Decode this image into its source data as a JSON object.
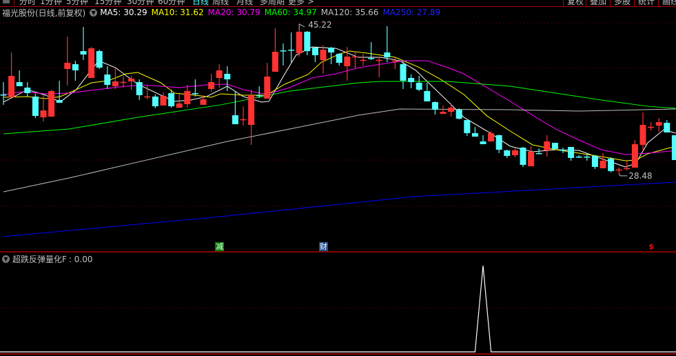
{
  "toolbar": {
    "tabs": [
      "分时",
      "1分钟",
      "5分钟",
      "15分钟",
      "30分钟",
      "60分钟",
      "日线",
      "周线",
      "月线",
      "多周期",
      "更多 >"
    ],
    "active_tab": "日线",
    "right_buttons": [
      "复权",
      "叠加",
      "多股",
      "统计",
      "画线"
    ]
  },
  "legend": {
    "title": "福光股份(日线,前复权)",
    "ma5": "MA5: 30.29",
    "ma10": "MA10: 31.62",
    "ma20": "MA20: 30.79",
    "ma60": "MA60: 34.97",
    "ma120": "MA120: 35.66",
    "ma250": "MA250: 27.89"
  },
  "colors": {
    "up": "#ff3232",
    "down": "#54ffff",
    "ma5": "#ffffff",
    "ma10": "#ffff00",
    "ma20": "#ff00ff",
    "ma60": "#00ff00",
    "ma120": "#c0c0c0",
    "ma250": "#0000ff",
    "grid": "#8b0000",
    "separator": "#b00000"
  },
  "chart_data": [
    {
      "type": "candlestick",
      "title": "福光股份(日线,前复权)",
      "ylim": [
        19.42,
        46.26
      ],
      "grid": true,
      "candles_ohlc": [
        [
          37.69,
          39.13,
          36.49,
          37.65
        ],
        [
          37.37,
          42.57,
          37.37,
          39.85
        ],
        [
          39.13,
          40.49,
          38.65,
          38.65
        ],
        [
          38.49,
          39.13,
          37.45,
          37.85
        ],
        [
          37.45,
          37.77,
          34.96,
          35.2
        ],
        [
          35.04,
          37.61,
          34.56,
          35.84
        ],
        [
          35.12,
          38.25,
          35.12,
          38.09
        ],
        [
          37.05,
          39.29,
          36.73,
          36.73
        ],
        [
          40.65,
          44.41,
          38.73,
          41.37
        ],
        [
          41.21,
          41.61,
          39.29,
          40.49
        ],
        [
          42.73,
          45.54,
          41.69,
          42.33
        ],
        [
          39.61,
          43.21,
          39.61,
          43.05
        ],
        [
          42.73,
          42.89,
          40.65,
          40.81
        ],
        [
          40.01,
          40.97,
          38.33,
          38.81
        ],
        [
          38.65,
          40.81,
          38.33,
          39.21
        ],
        [
          39.13,
          39.77,
          38.49,
          39.15
        ],
        [
          39.21,
          39.85,
          38.25,
          39.53
        ],
        [
          39.13,
          39.45,
          37.05,
          37.61
        ],
        [
          37.45,
          38.73,
          37.13,
          37.47
        ],
        [
          37.45,
          37.69,
          36.08,
          36.32
        ],
        [
          36.41,
          37.93,
          36.41,
          37.53
        ],
        [
          37.85,
          38.25,
          36.16,
          36.32
        ],
        [
          36.16,
          37.77,
          36.16,
          36.65
        ],
        [
          36.57,
          38.81,
          36.16,
          38.09
        ],
        [
          37.85,
          39.45,
          37.45,
          37.83
        ],
        [
          36.49,
          37.61,
          36.49,
          37.13
        ],
        [
          38.33,
          40.09,
          38.01,
          39.13
        ],
        [
          39.61,
          41.21,
          38.49,
          40.49
        ],
        [
          40.09,
          40.97,
          38.09,
          39.45
        ],
        [
          35.28,
          38.01,
          34.24,
          34.24
        ],
        [
          34.8,
          36.32,
          34.08,
          34.82
        ],
        [
          34.16,
          38.25,
          31.84,
          37.61
        ],
        [
          37.61,
          38.65,
          37.29,
          37.59
        ],
        [
          37.21,
          41.37,
          37.21,
          39.77
        ],
        [
          40.33,
          45.38,
          40.33,
          42.65
        ],
        [
          42.81,
          43.61,
          41.05,
          42.79
        ],
        [
          42.89,
          44.9,
          41.45,
          42.87
        ],
        [
          42.49,
          45.22,
          42.09,
          44.98
        ],
        [
          44.98,
          45.06,
          42.25,
          42.73
        ],
        [
          43.13,
          43.13,
          41.45,
          42.25
        ],
        [
          41.69,
          43.37,
          40.09,
          42.89
        ],
        [
          43.13,
          43.21,
          41.21,
          42.57
        ],
        [
          42.41,
          42.49,
          41.05,
          41.37
        ],
        [
          40.97,
          43.21,
          39.29,
          42.09
        ],
        [
          42.09,
          42.65,
          40.73,
          42.11
        ],
        [
          41.69,
          42.41,
          41.05,
          41.71
        ],
        [
          41.93,
          43.77,
          41.69,
          41.91
        ],
        [
          41.69,
          42.09,
          39.69,
          41.71
        ],
        [
          42.57,
          45.62,
          41.45,
          42.01
        ],
        [
          41.61,
          42.01,
          40.65,
          41.63
        ],
        [
          41.21,
          41.53,
          38.33,
          39.29
        ],
        [
          39.61,
          40.01,
          38.41,
          39.13
        ],
        [
          39.05,
          39.85,
          38.09,
          38.25
        ],
        [
          38.09,
          39.05,
          36.89,
          36.89
        ],
        [
          36.81,
          36.89,
          35.36,
          35.92
        ],
        [
          35.44,
          36.41,
          35.44,
          35.68
        ],
        [
          35.68,
          36.65,
          35.12,
          36.16
        ],
        [
          35.92,
          36.08,
          34.8,
          34.88
        ],
        [
          34.72,
          34.72,
          32.88,
          33.2
        ],
        [
          33.2,
          33.92,
          32.8,
          32.8
        ],
        [
          32.24,
          32.96,
          31.92,
          31.92
        ],
        [
          32.24,
          33.44,
          32.24,
          33.2
        ],
        [
          32.96,
          33.04,
          30.88,
          31.28
        ],
        [
          31.2,
          31.28,
          30.32,
          30.56
        ],
        [
          30.64,
          31.44,
          30.4,
          31.2
        ],
        [
          31.52,
          31.6,
          29.28,
          29.52
        ],
        [
          29.36,
          31.68,
          29.36,
          31.04
        ],
        [
          30.88,
          31.44,
          30.8,
          30.86
        ],
        [
          31.2,
          32.96,
          30.48,
          32.24
        ],
        [
          32.08,
          32.08,
          31.36,
          31.36
        ],
        [
          31.28,
          31.52,
          30.88,
          31.26
        ],
        [
          31.6,
          31.6,
          30.0,
          30.32
        ],
        [
          30.48,
          30.64,
          30.32,
          30.46
        ],
        [
          30.48,
          30.72,
          30.0,
          30.46
        ],
        [
          30.56,
          30.64,
          29.04,
          29.28
        ],
        [
          29.12,
          30.88,
          29.12,
          30.0
        ],
        [
          30.24,
          30.4,
          28.64,
          28.8
        ],
        [
          28.96,
          29.2,
          28.48,
          28.98
        ],
        [
          29.12,
          29.92,
          28.88,
          29.14
        ],
        [
          29.2,
          32.4,
          29.2,
          31.92
        ],
        [
          31.84,
          35.6,
          31.12,
          34.16
        ],
        [
          33.92,
          34.48,
          33.52,
          33.94
        ],
        [
          34.08,
          34.96,
          33.36,
          34.48
        ],
        [
          34.4,
          34.72,
          33.28,
          33.28
        ],
        [
          32.96,
          32.96,
          30.08,
          30.08
        ]
      ],
      "series": [
        {
          "name": "MA5",
          "points": [
            [
              0,
              36.81
            ],
            [
              3,
              38.25
            ],
            [
              5.3,
              37.61
            ],
            [
              7.1,
              36.81
            ],
            [
              9.1,
              38.25
            ],
            [
              11.9,
              41.61
            ],
            [
              14,
              40.81
            ],
            [
              16.8,
              38.89
            ],
            [
              19.7,
              37.61
            ],
            [
              21.4,
              36.89
            ],
            [
              23.4,
              37.05
            ],
            [
              25.4,
              37.45
            ],
            [
              28,
              38.65
            ],
            [
              30,
              37.45
            ],
            [
              32.3,
              36.81
            ],
            [
              33.2,
              36.89
            ],
            [
              35.2,
              40.09
            ],
            [
              36.6,
              42.25
            ],
            [
              38.6,
              43.21
            ],
            [
              41.6,
              43.05
            ],
            [
              44.4,
              42.01
            ],
            [
              47.2,
              42.01
            ],
            [
              49.6,
              41.61
            ],
            [
              51.6,
              40.49
            ],
            [
              53,
              39.21
            ],
            [
              55.6,
              36.89
            ],
            [
              57.6,
              35.04
            ],
            [
              60.5,
              33.44
            ],
            [
              63.4,
              31.68
            ],
            [
              66.2,
              31.04
            ],
            [
              69.1,
              31.28
            ],
            [
              72,
              31.2
            ],
            [
              74.8,
              30.24
            ],
            [
              77.8,
              29.28
            ],
            [
              79.1,
              29.68
            ],
            [
              80.6,
              32.08
            ],
            [
              82.6,
              33.6
            ],
            [
              84.1,
              33.2
            ]
          ]
        },
        {
          "name": "MA10",
          "points": [
            [
              0,
              37.37
            ],
            [
              3,
              37.45
            ],
            [
              5.3,
              37.21
            ],
            [
              7.1,
              37.45
            ],
            [
              9.1,
              38.25
            ],
            [
              11,
              39.05
            ],
            [
              13.1,
              39.29
            ],
            [
              15.3,
              40.09
            ],
            [
              16.8,
              40.25
            ],
            [
              19.7,
              39.05
            ],
            [
              21.4,
              37.85
            ],
            [
              24,
              37.61
            ],
            [
              26,
              37.37
            ],
            [
              27.2,
              37.77
            ],
            [
              30,
              37.61
            ],
            [
              32.9,
              37.61
            ],
            [
              35.2,
              38.89
            ],
            [
              38.1,
              40.01
            ],
            [
              39.8,
              41.45
            ],
            [
              42.1,
              42.41
            ],
            [
              43.3,
              42.73
            ],
            [
              45.5,
              42.49
            ],
            [
              49,
              42.01
            ],
            [
              51.9,
              40.89
            ],
            [
              54.7,
              39.45
            ],
            [
              57.6,
              37.69
            ],
            [
              60.5,
              35.2
            ],
            [
              63.4,
              33.44
            ],
            [
              66.2,
              31.84
            ],
            [
              69.1,
              31.28
            ],
            [
              72,
              30.88
            ],
            [
              74.8,
              30.48
            ],
            [
              77.8,
              30.0
            ],
            [
              79.1,
              30.08
            ],
            [
              80.6,
              30.8
            ],
            [
              83.4,
              31.52
            ],
            [
              84.1,
              31.52
            ]
          ]
        },
        {
          "name": "MA20",
          "points": [
            [
              0,
              37.69
            ],
            [
              2.4,
              38.01
            ],
            [
              5.3,
              37.77
            ],
            [
              8.2,
              37.85
            ],
            [
              11.6,
              38.25
            ],
            [
              15.3,
              38.65
            ],
            [
              17.4,
              38.81
            ],
            [
              22,
              38.49
            ],
            [
              25.4,
              38.81
            ],
            [
              28,
              38.89
            ],
            [
              30,
              38.25
            ],
            [
              32.9,
              37.69
            ],
            [
              35.8,
              38.49
            ],
            [
              38.6,
              39.61
            ],
            [
              41.6,
              40.09
            ],
            [
              44.4,
              40.81
            ],
            [
              47.2,
              41.21
            ],
            [
              50.2,
              41.61
            ],
            [
              53,
              41.61
            ],
            [
              55.6,
              40.81
            ],
            [
              57.6,
              40.09
            ],
            [
              60.5,
              38.49
            ],
            [
              63.4,
              36.89
            ],
            [
              66.2,
              35.28
            ],
            [
              69.1,
              33.68
            ],
            [
              72,
              32.4
            ],
            [
              74.8,
              31.28
            ],
            [
              77.8,
              30.72
            ],
            [
              80.6,
              30.88
            ],
            [
              83.4,
              31.12
            ],
            [
              84.1,
              31.12
            ]
          ]
        },
        {
          "name": "MA60",
          "points": [
            [
              0,
              33.12
            ],
            [
              8.2,
              33.68
            ],
            [
              16.8,
              35.04
            ],
            [
              27.2,
              36.49
            ],
            [
              35.8,
              38.09
            ],
            [
              44.4,
              39.05
            ],
            [
              47.2,
              39.21
            ],
            [
              55.6,
              39.21
            ],
            [
              63.4,
              38.65
            ],
            [
              69.1,
              37.85
            ],
            [
              74.8,
              37.05
            ],
            [
              80.6,
              36.32
            ],
            [
              84.1,
              36.08
            ]
          ]
        },
        {
          "name": "MA120",
          "points": [
            [
              0,
              26.39
            ],
            [
              8.2,
              27.99
            ],
            [
              16.8,
              29.84
            ],
            [
              28,
              32.24
            ],
            [
              35.8,
              33.68
            ],
            [
              44.4,
              35.28
            ],
            [
              49.6,
              36.0
            ],
            [
              63.4,
              35.92
            ],
            [
              72,
              35.76
            ],
            [
              84.1,
              36.0
            ]
          ]
        },
        {
          "name": "MA250",
          "points": [
            [
              0,
              21.19
            ],
            [
              25.4,
              23.35
            ],
            [
              51.3,
              25.83
            ],
            [
              84.1,
              27.51
            ]
          ]
        }
      ],
      "annotations": {
        "high_label": "45.22",
        "high_index": 37,
        "low_label": "28.48",
        "low_index": 77
      },
      "markers": [
        {
          "text": "减",
          "index": 27,
          "color": "#008000"
        },
        {
          "text": "财",
          "index": 40,
          "color": "#1f4e8c"
        },
        {
          "text": "$",
          "index": 81,
          "color": "#ff0000"
        }
      ]
    },
    {
      "type": "line",
      "title": "超跌反弹量化F",
      "value_label": ": 0.00",
      "ylim": [
        0,
        1
      ],
      "signal_index": 60,
      "signal_value": 1,
      "count": 85
    }
  ]
}
